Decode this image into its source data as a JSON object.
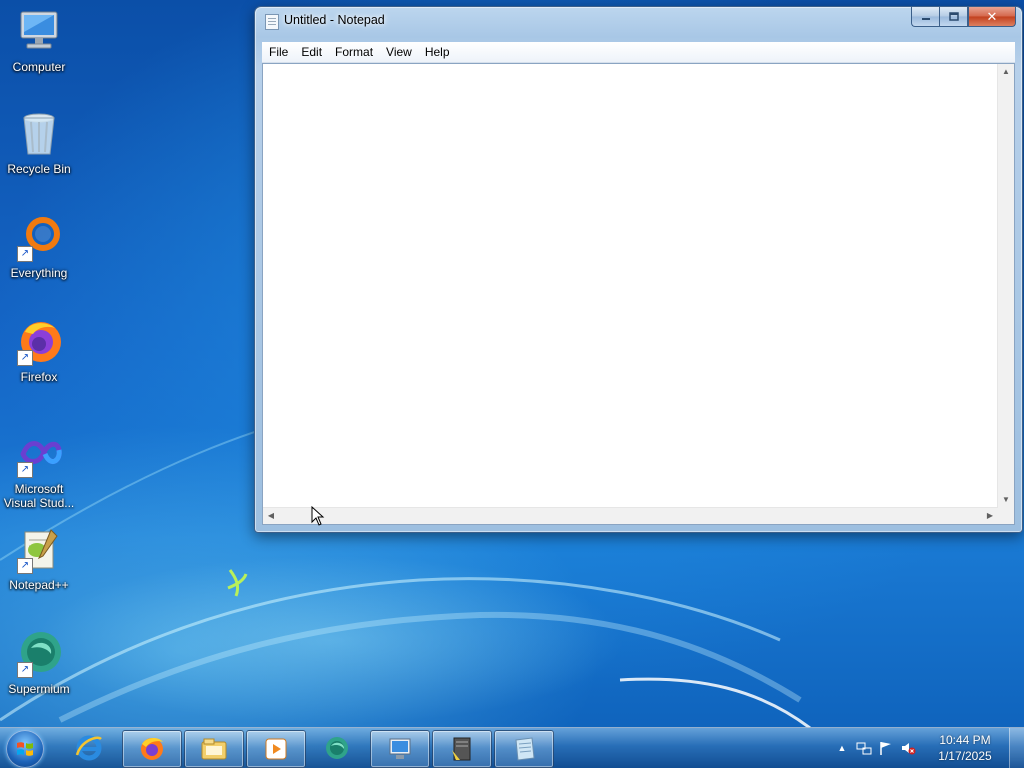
{
  "desktop": {
    "icons": [
      {
        "label": "Computer",
        "icon": "computer-icon"
      },
      {
        "label": "Recycle Bin",
        "icon": "recycle-bin-icon"
      },
      {
        "label": "Everything",
        "icon": "everything-search-icon"
      },
      {
        "label": "Firefox",
        "icon": "firefox-icon"
      },
      {
        "label": "Microsoft Visual Stud...",
        "icon": "visual-studio-icon"
      },
      {
        "label": "Notepad++",
        "icon": "notepad-plus-plus-icon"
      },
      {
        "label": "Supermium",
        "icon": "supermium-icon"
      }
    ]
  },
  "notepad": {
    "title": "Untitled - Notepad",
    "menu": [
      "File",
      "Edit",
      "Format",
      "View",
      "Help"
    ],
    "content": "",
    "close_glyph": "✕"
  },
  "taskbar": {
    "apps": [
      {
        "name": "Internet Explorer",
        "icon": "internet-explorer-icon",
        "active": false
      },
      {
        "name": "Firefox",
        "icon": "firefox-icon",
        "active": true
      },
      {
        "name": "Windows Explorer",
        "icon": "file-explorer-icon",
        "active": true
      },
      {
        "name": "Windows Media Player",
        "icon": "media-player-icon",
        "active": true
      },
      {
        "name": "Supermium",
        "icon": "supermium-icon",
        "active": false
      },
      {
        "name": "Remote Desktop",
        "icon": "remote-desktop-icon",
        "active": true
      },
      {
        "name": "Application",
        "icon": "app-settings-icon",
        "active": true
      },
      {
        "name": "Notepad",
        "icon": "notepad-icon",
        "active": true
      }
    ],
    "tray": {
      "time": "10:44 PM",
      "date": "1/17/2025",
      "show_hidden_glyph": "▲"
    }
  }
}
